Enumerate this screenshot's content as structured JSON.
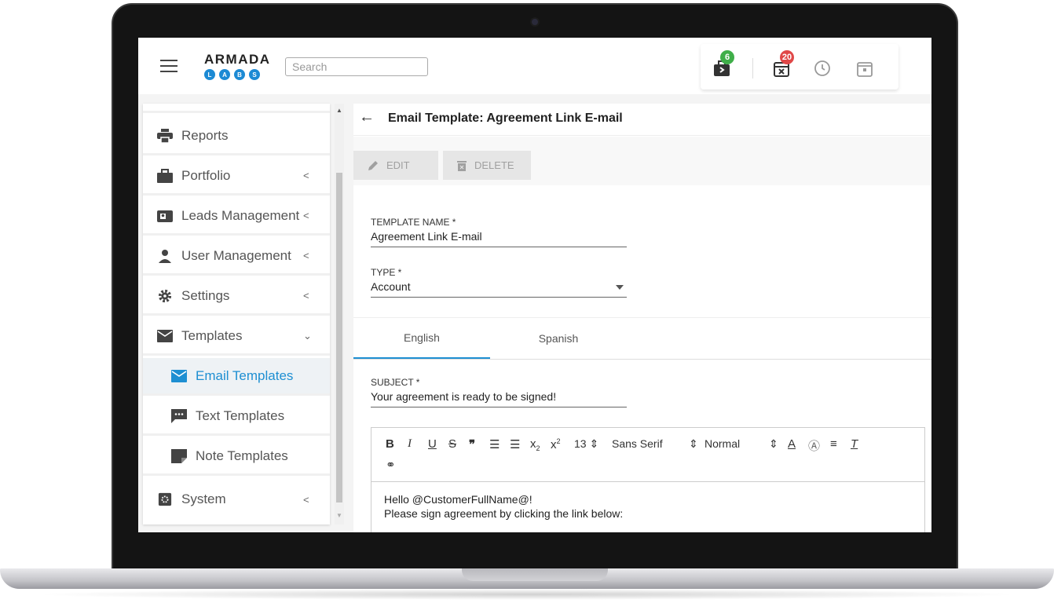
{
  "header": {
    "brand_name": "ARMADA",
    "brand_letters": [
      "L",
      "A",
      "B",
      "S"
    ],
    "search_placeholder": "Search",
    "badges": {
      "briefcase": "6",
      "calendar": "20"
    }
  },
  "sidebar": {
    "items": [
      {
        "label": "Reports",
        "icon": "printer-icon"
      },
      {
        "label": "Portfolio",
        "icon": "briefcase-icon",
        "chevron": "<"
      },
      {
        "label": "Leads Management",
        "icon": "contact-card-icon",
        "chevron": "<"
      },
      {
        "label": "User Management",
        "icon": "person-icon",
        "chevron": "<"
      },
      {
        "label": "Settings",
        "icon": "gear-icon",
        "chevron": "<"
      },
      {
        "label": "Templates",
        "icon": "envelope-icon",
        "chevron": "⌄"
      },
      {
        "label": "Email Templates",
        "icon": "envelope-icon"
      },
      {
        "label": "Text Templates",
        "icon": "message-icon"
      },
      {
        "label": "Note Templates",
        "icon": "note-icon"
      },
      {
        "label": "System",
        "icon": "chip-icon",
        "chevron": "<"
      }
    ]
  },
  "main": {
    "title": "Email Template: Agreement Link E-mail",
    "edit_label": "EDIT",
    "delete_label": "DELETE",
    "template_name": {
      "label": "TEMPLATE NAME *",
      "value": "Agreement Link E-mail"
    },
    "type": {
      "label": "TYPE *",
      "value": "Account"
    },
    "tabs": [
      "English",
      "Spanish"
    ],
    "subject": {
      "label": "SUBJECT *",
      "value": "Your agreement is ready to be signed!"
    },
    "editor": {
      "font_size": "13",
      "font_family": "Sans Serif",
      "format": "Normal",
      "body_lines": [
        "Hello @CustomerFullName@!",
        "Please sign agreement by clicking the link below:"
      ]
    }
  },
  "colors": {
    "accent": "#1e8fd2",
    "badge_green": "#3fae49",
    "badge_red": "#e04848"
  }
}
